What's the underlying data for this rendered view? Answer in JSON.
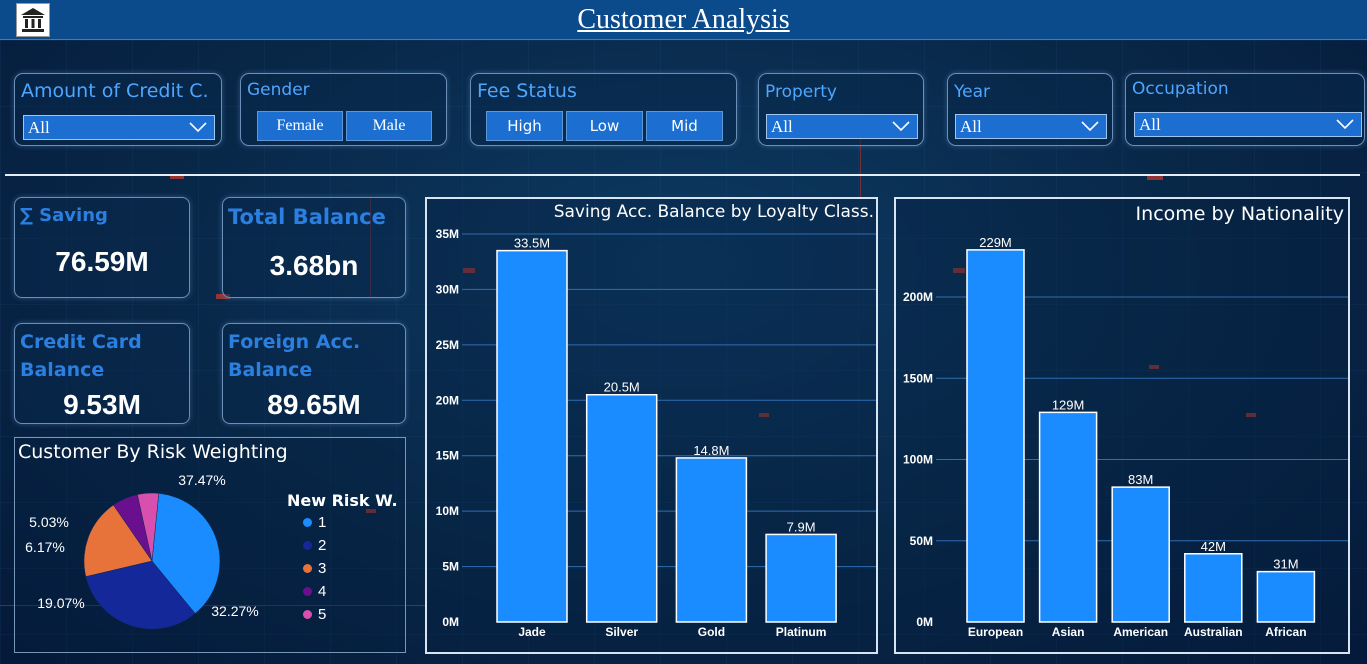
{
  "header": {
    "title": "Customer Analysis",
    "logo_icon": "bank-icon"
  },
  "slicers": {
    "credit": {
      "label": "Amount of Credit C.",
      "value": "All"
    },
    "gender": {
      "label": "Gender",
      "options": [
        "Female",
        "Male"
      ]
    },
    "fee": {
      "label": "Fee Status",
      "options": [
        "High",
        "Low",
        "Mid"
      ]
    },
    "property": {
      "label": "Property",
      "value": "All"
    },
    "year": {
      "label": "Year",
      "value": "All"
    },
    "occupation": {
      "label": "Occupation",
      "value": "All"
    }
  },
  "cards": {
    "saving": {
      "label": "∑ Saving",
      "value": "76.59M"
    },
    "total_balance": {
      "label": "Total Balance",
      "value": "3.68bn"
    },
    "credit_card": {
      "label": "Credit Card Balance",
      "value": "9.53M"
    },
    "foreign": {
      "label": "Foreign Acc. Balance",
      "value": "89.65M"
    }
  },
  "colors": {
    "bar": "#1a8cff",
    "header": "#0b4a8b",
    "accent": "#2a7fe0"
  },
  "chart_data": [
    {
      "type": "pie",
      "title": "Customer By Risk Weighting",
      "legend_title": "New Risk W.",
      "categories": [
        "1",
        "2",
        "3",
        "4",
        "5"
      ],
      "values": [
        37.47,
        32.27,
        19.07,
        6.17,
        5.03
      ],
      "labels": [
        "37.47%",
        "32.27%",
        "19.07%",
        "6.17%",
        "5.03%"
      ],
      "colors": [
        "#1a8cff",
        "#14289a",
        "#e8733a",
        "#6a0f8e",
        "#d94fae"
      ],
      "legend_position": "right"
    },
    {
      "type": "bar",
      "title": "Saving Acc. Balance by Loyalty Class.",
      "categories": [
        "Jade",
        "Silver",
        "Gold",
        "Platinum"
      ],
      "values": [
        33.5,
        20.5,
        14.8,
        7.9
      ],
      "data_labels": [
        "33.5M",
        "20.5M",
        "14.8M",
        "7.9M"
      ],
      "yticks": [
        "0M",
        "5M",
        "10M",
        "15M",
        "20M",
        "25M",
        "30M",
        "35M"
      ],
      "ylim": [
        0,
        35
      ],
      "grid": true
    },
    {
      "type": "bar",
      "title": "Income by Nationality",
      "categories": [
        "European",
        "Asian",
        "American",
        "Australian",
        "African"
      ],
      "values": [
        229,
        129,
        83,
        42,
        31
      ],
      "data_labels": [
        "229M",
        "129M",
        "83M",
        "42M",
        "31M"
      ],
      "yticks": [
        "0M",
        "50M",
        "100M",
        "150M",
        "200M"
      ],
      "ylim": [
        0,
        200
      ],
      "grid": true
    }
  ]
}
